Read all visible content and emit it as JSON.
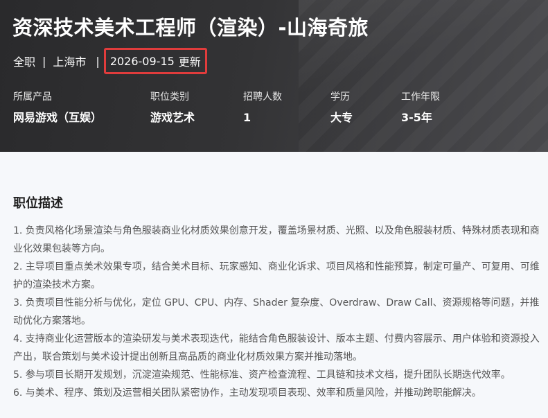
{
  "job": {
    "title": "资深技术美术工程师（渲染）-山海奇旅",
    "type": "全职",
    "city": "上海市",
    "updated_date": "2026-09-15",
    "updated_label": "更新"
  },
  "info": [
    {
      "label": "所属产品",
      "value": "网易游戏（互娱）"
    },
    {
      "label": "职位类别",
      "value": "游戏艺术"
    },
    {
      "label": "招聘人数",
      "value": "1"
    },
    {
      "label": "学历",
      "value": "大专"
    },
    {
      "label": "工作年限",
      "value": "3-5年"
    }
  ],
  "description": {
    "title": "职位描述",
    "items": [
      "1. 负责风格化场景渲染与角色服装商业化材质效果创意开发，覆盖场景材质、光照、以及角色服装材质、特殊材质表现和商业化效果包装等方向。",
      "2. 主导项目重点美术效果专项，结合美术目标、玩家感知、商业化诉求、项目风格和性能预算，制定可量产、可复用、可维护的渲染技术方案。",
      "3. 负责项目性能分析与优化，定位 GPU、CPU、内存、Shader 复杂度、Overdraw、Draw Call、资源规格等问题，并推动优化方案落地。",
      "4. 支持商业化运营版本的渲染研发与美术表现迭代，能结合角色服装设计、版本主题、付费内容展示、用户体验和资源投入产出，联合策划与美术设计提出创新且高品质的商业化材质效果方案并推动落地。",
      "5. 参与项目长期开发规划，沉淀渲染规范、性能标准、资产检查流程、工具链和技术文档，提升团队长期迭代效率。",
      "6. 与美术、程序、策划及运营相关团队紧密协作，主动发现项目表现、效率和质量风险，并推动跨职能解决。"
    ]
  },
  "colors": {
    "highlight_border": "#e03c3c",
    "hero_bg": "#333335",
    "page_bg": "#f6f8fb"
  }
}
